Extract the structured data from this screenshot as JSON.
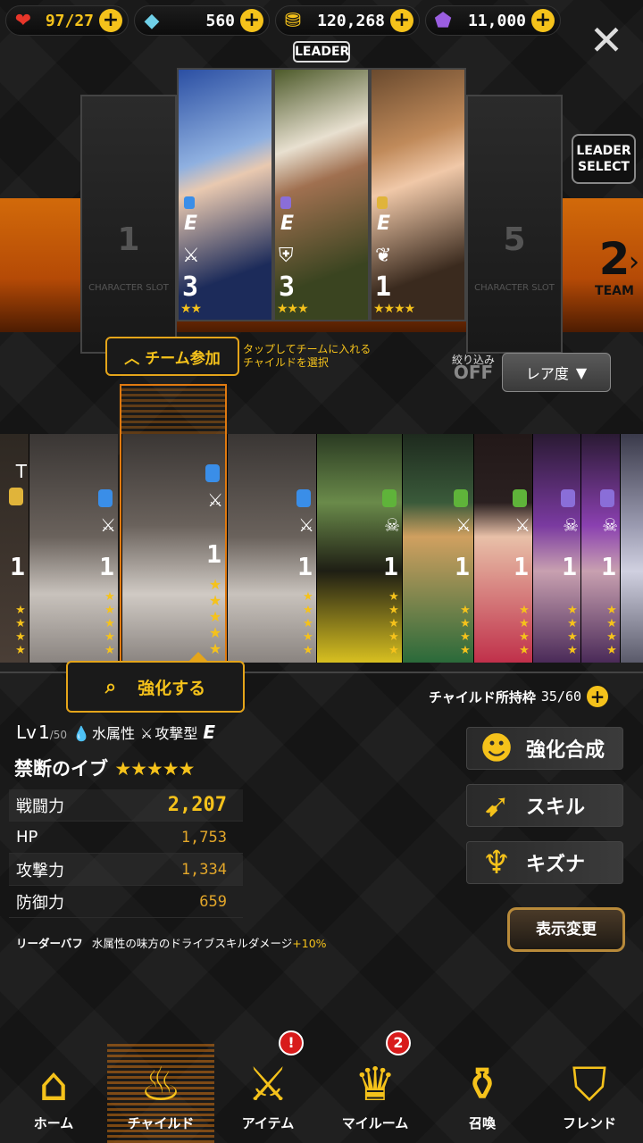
{
  "resources": {
    "stamina": "97/27",
    "gems": "560",
    "gold": "120,268",
    "crystal": "11,000"
  },
  "team": {
    "leader_tag": "LEADER",
    "empty_slot_label": "CHARACTER SLOT",
    "slots": [
      {
        "type": "empty",
        "number": "1"
      },
      {
        "type": "char",
        "rank": "E",
        "level": "3",
        "stars": "★★",
        "color": "#2b4fa3",
        "elem": "#3a8ee8",
        "type_icon": "⚔"
      },
      {
        "type": "char",
        "rank": "E",
        "level": "3",
        "stars": "★★★",
        "color": "#4d5a2a",
        "elem": "#8a6ed8",
        "type_icon": "⛨"
      },
      {
        "type": "char",
        "rank": "E",
        "level": "1",
        "stars": "★★★★",
        "color": "#6a4a2e",
        "elem": "#e0b43a",
        "type_icon": "❦"
      },
      {
        "type": "empty",
        "number": "5"
      }
    ],
    "leader_select": "LEADER SELECT",
    "team_number": "2",
    "team_label": "TEAM"
  },
  "filters": {
    "join_label": "チーム参加",
    "hint": "タップしてチームに入れる\nチャイルドを選択",
    "filter_label": "絞り込み",
    "filter_state": "OFF",
    "rarity": "レア度"
  },
  "children": [
    {
      "level": "1",
      "elem": "#e0b43a",
      "icon": "T",
      "bg": "#3a2f2a"
    },
    {
      "level": "1",
      "elem": "#3a8ee8",
      "icon": "⚔",
      "bg": "#4a4542"
    },
    {
      "level": "1",
      "elem": "#3a8ee8",
      "icon": "⚔",
      "bg": "#5a5048"
    },
    {
      "level": "1",
      "elem": "#3a8ee8",
      "icon": "⚔",
      "bg": "#4a4542"
    },
    {
      "level": "1",
      "elem": "#5fb33a",
      "icon": "☠",
      "bg": "#2f3a22"
    },
    {
      "level": "1",
      "elem": "#5fb33a",
      "icon": "⚔",
      "bg": "#2a3a2a"
    },
    {
      "level": "1",
      "elem": "#5fb33a",
      "icon": "⚔",
      "bg": "#3a2228"
    },
    {
      "level": "1",
      "elem": "#8a6ed8",
      "icon": "☠",
      "bg": "#3a2a44"
    },
    {
      "level": "1",
      "elem": "#8a6ed8",
      "icon": "☠",
      "bg": "#3e2a48"
    },
    {
      "level": "",
      "elem": "#8a6ed8",
      "icon": "",
      "bg": "#5a5a6a"
    }
  ],
  "enhance_label": "強化する",
  "detail": {
    "lv_prefix": "Lv",
    "level": "1",
    "level_max": "/50",
    "element": "水属性",
    "attack_type": "攻撃型",
    "class_rank": "E",
    "name": "禁断のイブ",
    "name_stars": "★★★★★",
    "stats": [
      {
        "label": "戦闘力",
        "value": "2,207"
      },
      {
        "label": "HP",
        "value": "1,753"
      },
      {
        "label": "攻撃力",
        "value": "1,334"
      },
      {
        "label": "防御力",
        "value": "659"
      }
    ],
    "buff_label": "リーダーバフ",
    "buff_text": "水属性の味方のドライブスキルダメージ",
    "buff_pct": "+10%"
  },
  "owned": {
    "label": "チャイルド所持枠",
    "value": "35/60"
  },
  "side_buttons": {
    "fusion": "強化合成",
    "skill": "スキル",
    "bond": "キズナ"
  },
  "display_change": "表示変更",
  "nav": {
    "home": "ホーム",
    "child": "チャイルド",
    "item": "アイテム",
    "item_badge": "!",
    "myroom": "マイルーム",
    "myroom_badge": "2",
    "summon": "召喚",
    "friend": "フレンド"
  },
  "colors": {
    "accent": "#f5c21b",
    "orange": "#d26a0a"
  }
}
